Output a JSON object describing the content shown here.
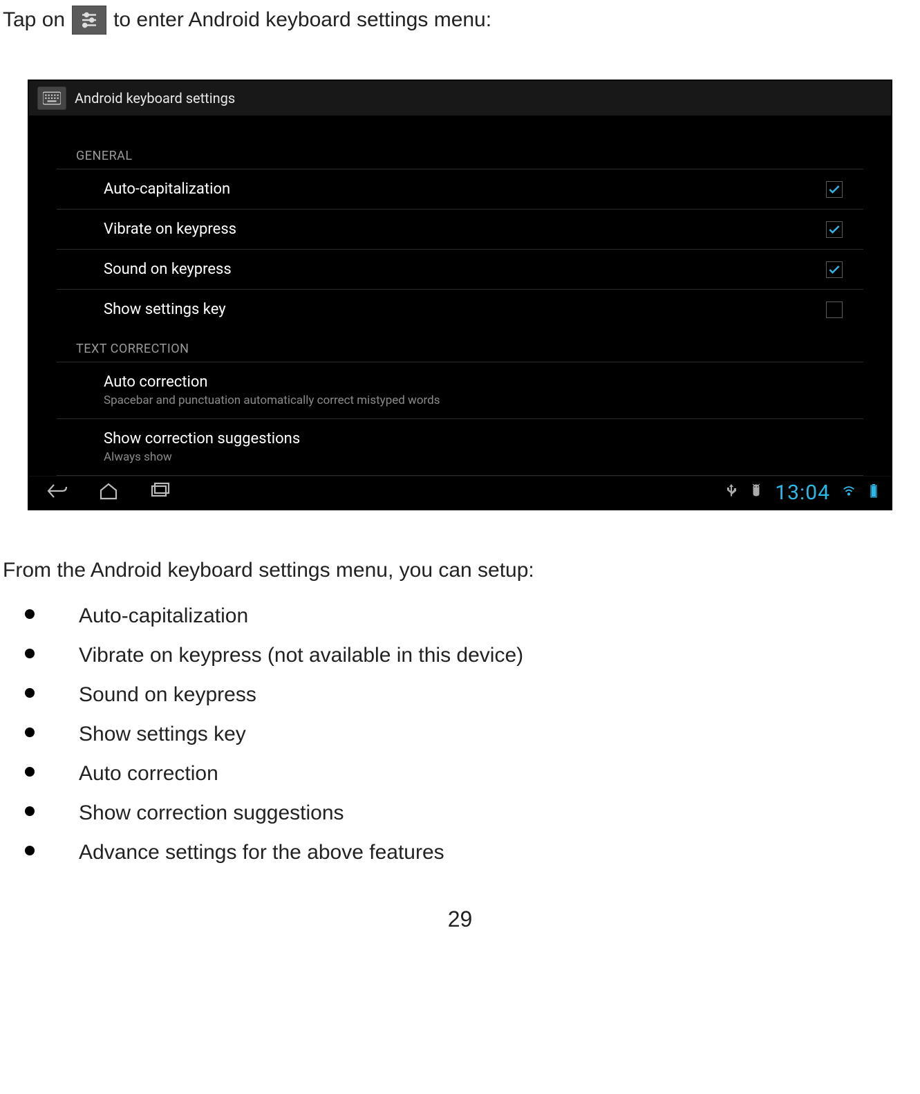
{
  "intro": {
    "prefix": "Tap on",
    "suffix": "to enter Android keyboard settings menu:"
  },
  "android": {
    "title": "Android keyboard settings",
    "sections": {
      "general": {
        "header": "GENERAL",
        "items": [
          {
            "label": "Auto-capitalization",
            "checked": true
          },
          {
            "label": "Vibrate on keypress",
            "checked": true
          },
          {
            "label": "Sound on keypress",
            "checked": true
          },
          {
            "label": "Show settings key",
            "checked": false
          }
        ]
      },
      "correction": {
        "header": "TEXT CORRECTION",
        "items": [
          {
            "label": "Auto correction",
            "sub": "Spacebar and punctuation automatically correct mistyped words"
          },
          {
            "label": "Show correction suggestions",
            "sub": "Always show"
          }
        ]
      }
    },
    "clock": "13:04"
  },
  "post": {
    "lead": "From the Android keyboard settings menu, you can setup:",
    "features": [
      "Auto-capitalization",
      "Vibrate on keypress (not available in this device)",
      "Sound on keypress",
      "Show settings key",
      "Auto correction",
      "Show correction suggestions",
      "Advance settings for the above features"
    ]
  },
  "page_number": "29"
}
